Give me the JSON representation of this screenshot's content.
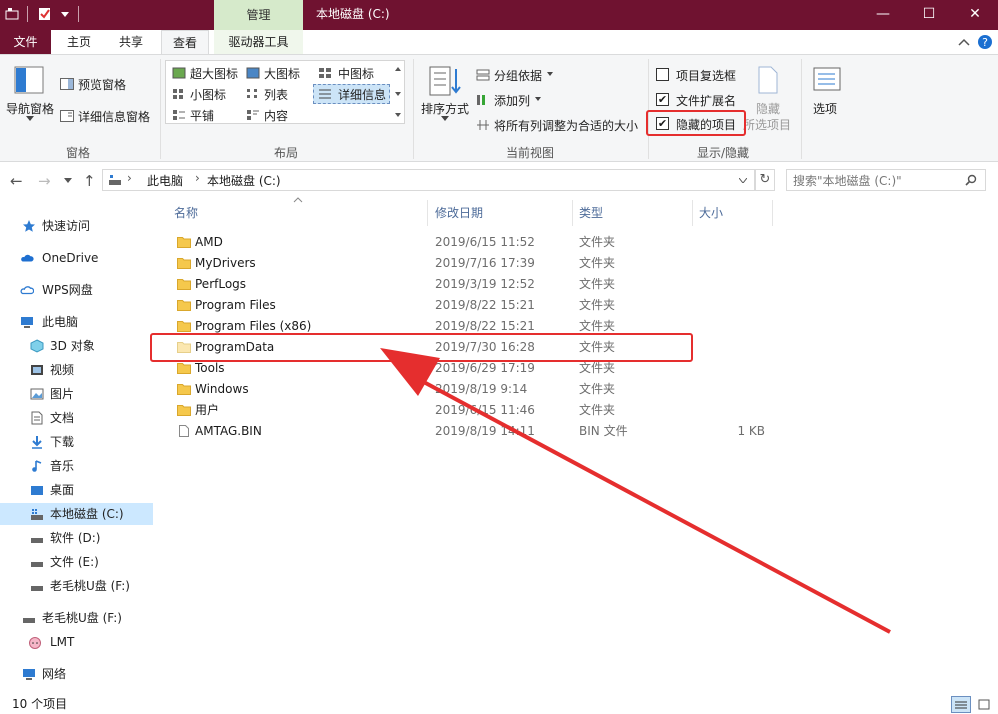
{
  "window": {
    "title": "本地磁盘 (C:)",
    "tool_tab_header": "管理",
    "minimize": "—",
    "maximize": "☐",
    "close": "✕"
  },
  "tabs": {
    "file": "文件",
    "home": "主页",
    "share": "共享",
    "view": "查看",
    "drive_tools": "驱动器工具"
  },
  "ribbon": {
    "pane_group": {
      "label": "窗格",
      "nav_pane": "导航窗格",
      "preview_pane": "预览窗格",
      "details_pane": "详细信息窗格"
    },
    "layout_group": {
      "label": "布局",
      "items": [
        "超大图标",
        "大图标",
        "中图标",
        "小图标",
        "列表",
        "详细信息",
        "平铺",
        "内容"
      ]
    },
    "current_view_group": {
      "label": "当前视图",
      "sort_by": "排序方式",
      "group_by": "分组依据",
      "add_column": "添加列",
      "fit_columns": "将所有列调整为合适的大小"
    },
    "show_hide_group": {
      "label": "显示/隐藏",
      "item_checkboxes": "项目复选框",
      "file_extensions": "文件扩展名",
      "hidden_items": "隐藏的项目",
      "hide_selected": "隐藏",
      "hide_selected_2": "所选项目",
      "checks": {
        "item_checkboxes": false,
        "file_extensions": true,
        "hidden_items": true
      }
    },
    "options": "选项"
  },
  "address": {
    "path": [
      "此电脑",
      "本地磁盘 (C:)"
    ],
    "search_placeholder": "搜索\"本地磁盘 (C:)\""
  },
  "nav_pane": {
    "quick_access": "快速访问",
    "onedrive": "OneDrive",
    "wps": "WPS网盘",
    "this_pc": "此电脑",
    "objects3d": "3D 对象",
    "videos": "视频",
    "pictures": "图片",
    "documents": "文档",
    "downloads": "下载",
    "music": "音乐",
    "desktop": "桌面",
    "local_c": "本地磁盘 (C:)",
    "soft_d": "软件 (D:)",
    "file_e": "文件 (E:)",
    "usb_f": "老毛桃U盘 (F:)",
    "usb_f2": "老毛桃U盘 (F:)",
    "lmt": "LMT",
    "network": "网络"
  },
  "columns": {
    "name": "名称",
    "date": "修改日期",
    "type": "类型",
    "size": "大小"
  },
  "files": [
    {
      "name": "AMD",
      "date": "2019/6/15 11:52",
      "type": "文件夹",
      "size": ""
    },
    {
      "name": "MyDrivers",
      "date": "2019/7/16 17:39",
      "type": "文件夹",
      "size": ""
    },
    {
      "name": "PerfLogs",
      "date": "2019/3/19 12:52",
      "type": "文件夹",
      "size": ""
    },
    {
      "name": "Program Files",
      "date": "2019/8/22 15:21",
      "type": "文件夹",
      "size": ""
    },
    {
      "name": "Program Files (x86)",
      "date": "2019/8/22 15:21",
      "type": "文件夹",
      "size": ""
    },
    {
      "name": "ProgramData",
      "date": "2019/7/30 16:28",
      "type": "文件夹",
      "size": ""
    },
    {
      "name": "Tools",
      "date": "2019/6/29 17:19",
      "type": "文件夹",
      "size": ""
    },
    {
      "name": "Windows",
      "date": "2019/8/19 9:14",
      "type": "文件夹",
      "size": ""
    },
    {
      "name": "用户",
      "date": "2019/6/15 11:46",
      "type": "文件夹",
      "size": ""
    },
    {
      "name": "AMTAG.BIN",
      "date": "2019/8/19 14:11",
      "type": "BIN 文件",
      "size": "1 KB"
    }
  ],
  "status": {
    "item_count": "10 个项目"
  },
  "colors": {
    "titlebar": "#6f1230",
    "accent_red": "#e52e2e",
    "folder": "#f5c84c",
    "selection": "#cce8ff"
  }
}
